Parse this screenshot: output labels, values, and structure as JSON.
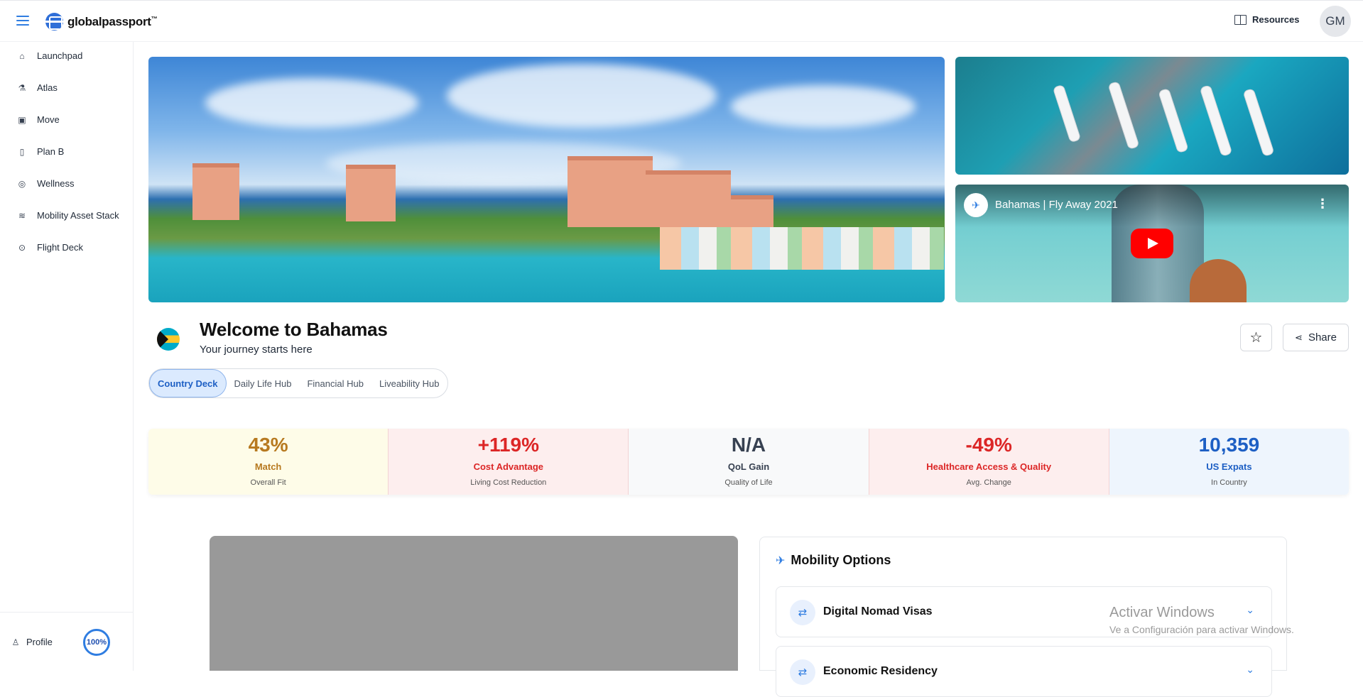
{
  "header": {
    "logo_text": "globalpassport",
    "logo_tm": "™",
    "resources_label": "Resources",
    "avatar_initials": "GM"
  },
  "sidebar": {
    "items": [
      {
        "label": "Launchpad",
        "icon": "home-icon"
      },
      {
        "label": "Atlas",
        "icon": "flask-icon"
      },
      {
        "label": "Move",
        "icon": "calendar-icon"
      },
      {
        "label": "Plan B",
        "icon": "notebook-icon"
      },
      {
        "label": "Wellness",
        "icon": "compass-icon"
      },
      {
        "label": "Mobility Asset Stack",
        "icon": "layers-icon"
      },
      {
        "label": "Flight Deck",
        "icon": "target-icon"
      }
    ],
    "profile_label": "Profile",
    "profile_progress": "100%"
  },
  "video": {
    "title": "Bahamas | Fly Away 2021"
  },
  "page": {
    "title": "Welcome to Bahamas",
    "subtitle": "Your journey starts here",
    "share_label": "Share"
  },
  "tabs": [
    {
      "label": "Country Deck",
      "active": true
    },
    {
      "label": "Daily Life Hub",
      "active": false
    },
    {
      "label": "Financial Hub",
      "active": false
    },
    {
      "label": "Liveability Hub",
      "active": false
    }
  ],
  "stats": [
    {
      "value": "43%",
      "label": "Match",
      "sub": "Overall Fit",
      "color": "#b7791f",
      "bg": "#fefce8"
    },
    {
      "value": "+119%",
      "label": "Cost Advantage",
      "sub": "Living Cost Reduction",
      "color": "#dc2626",
      "bg": "#fdeeee"
    },
    {
      "value": "N/A",
      "label": "QoL Gain",
      "sub": "Quality of Life",
      "color": "#374151",
      "bg": "#f8f9fa"
    },
    {
      "value": "-49%",
      "label": "Healthcare Access & Quality",
      "sub": "Avg. Change",
      "color": "#dc2626",
      "bg": "#fdeeee"
    },
    {
      "value": "10,359",
      "label": "US Expats",
      "sub": "In Country",
      "color": "#1d5fc4",
      "bg": "#eef5fd"
    }
  ],
  "mobility": {
    "title": "Mobility Options",
    "options": [
      {
        "label": "Digital Nomad Visas"
      },
      {
        "label": "Economic Residency"
      }
    ]
  },
  "watermark": {
    "title": "Activar Windows",
    "subtitle": "Ve a Configuración para activar Windows."
  },
  "colors": {
    "accent": "#2f7de1",
    "tab_active_bg": "#dbeafe"
  }
}
